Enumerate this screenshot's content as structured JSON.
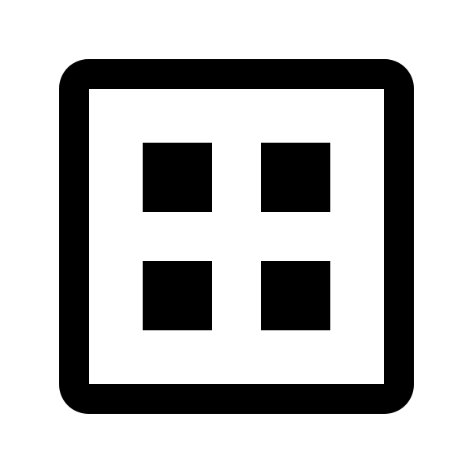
{
  "icon": {
    "name": "grid-view-icon",
    "foreground": "#000000",
    "background": "#ffffff"
  }
}
